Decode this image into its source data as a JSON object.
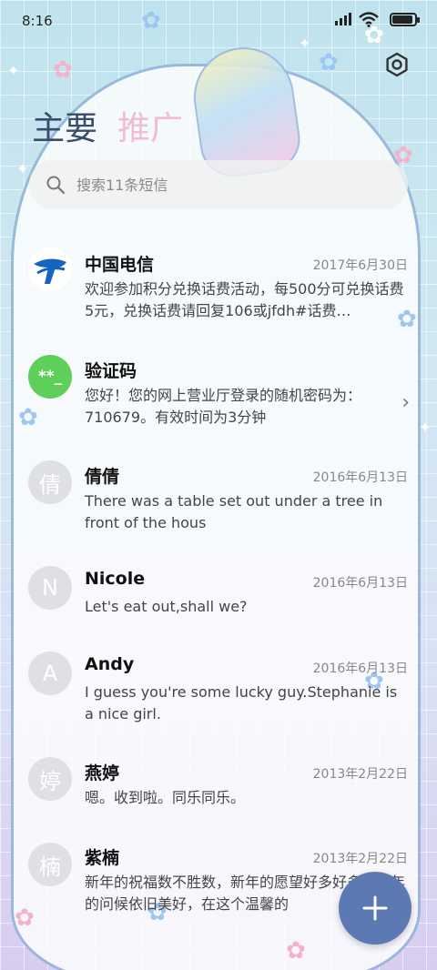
{
  "status_bar": {
    "time": "8:16"
  },
  "tabs": [
    {
      "label": "主要"
    },
    {
      "label": "推广"
    }
  ],
  "search": {
    "placeholder": "搜索11条短信"
  },
  "conversations": [
    {
      "name": "中国电信",
      "date": "2017年6月30日",
      "preview": "欢迎参加积分兑换话费活动，每500分可兑换话费5元，兑换话费请回复106或jfdh#话费…",
      "avatar": "china-telecom-logo"
    },
    {
      "name": "验证码",
      "date": "",
      "preview": "您好！您的网上营业厅登录的随机密码为：710679。有效时间为3分钟",
      "avatar_text": "**_"
    },
    {
      "name": "倩倩",
      "date": "2016年6月13日",
      "preview": "There was a table set out under a tree in front of the hous",
      "avatar_text": "倩"
    },
    {
      "name": "Nicole",
      "date": "2016年6月13日",
      "preview": "Let's eat out,shall we?",
      "avatar_text": "N"
    },
    {
      "name": "Andy",
      "date": "2016年6月13日",
      "preview": "I guess you're some lucky guy.Stephanie is a nice girl.",
      "avatar_text": "A"
    },
    {
      "name": "燕婷",
      "date": "2013年2月22日",
      "preview": "嗯。收到啦。同乐同乐。",
      "avatar_text": "婷"
    },
    {
      "name": "紫楠",
      "date": "2013年2月22日",
      "preview": "新年的祝福数不胜数，新年的愿望好多好多，新年的问候依旧美好，在这个温馨的",
      "avatar_text": "楠"
    }
  ],
  "icons": {
    "settings": "gear-icon",
    "search": "search-icon",
    "new_message": "plus-icon",
    "expand": "chevron-right-icon"
  },
  "colors": {
    "accent": "#5c79b3",
    "verify_avatar": "#5ed05a",
    "telecom_blue": "#1565c0",
    "inactive_tab": "#f0bcd6"
  }
}
